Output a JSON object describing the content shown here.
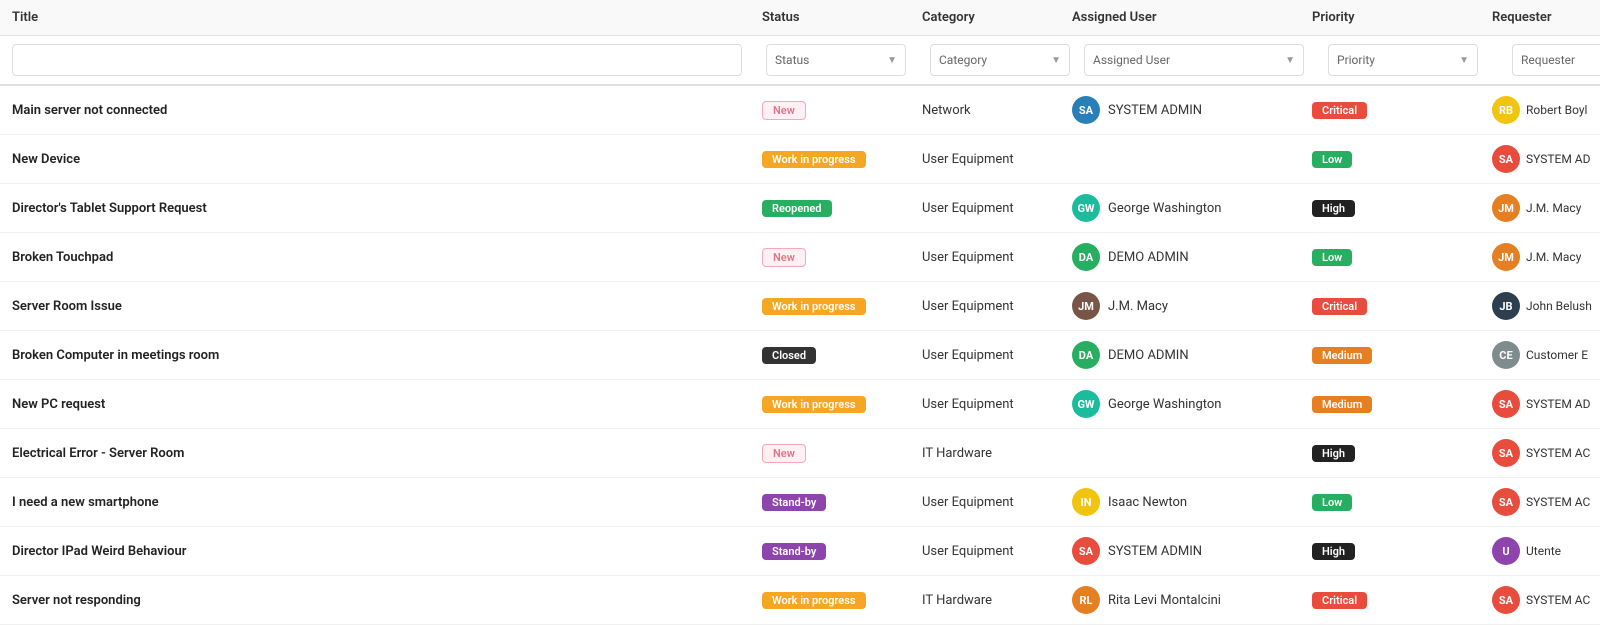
{
  "columns": {
    "title": "Title",
    "status": "Status",
    "category": "Category",
    "assigned_user": "Assigned User",
    "priority": "Priority",
    "requester": "Requester"
  },
  "filters": {
    "search_placeholder": "",
    "status_label": "Status",
    "category_label": "Category",
    "assigned_user_label": "Assigned User",
    "priority_label": "Priority",
    "requester_label": "Requester"
  },
  "rows": [
    {
      "title": "Main server not connected",
      "status": "New",
      "status_type": "new",
      "category": "Network",
      "assigned_user": "SYSTEM ADMIN",
      "assigned_avatar_color": "av-blue",
      "assigned_initials": "SA",
      "priority": "Critical",
      "priority_type": "critical",
      "requester": "Robert Boyl",
      "requester_avatar_color": "av-yellow",
      "requester_initials": "RB"
    },
    {
      "title": "New Device",
      "status": "Work in progress",
      "status_type": "wip",
      "category": "User Equipment",
      "assigned_user": "",
      "assigned_avatar_color": "",
      "assigned_initials": "",
      "priority": "Low",
      "priority_type": "low",
      "requester": "SYSTEM AD",
      "requester_avatar_color": "av-red",
      "requester_initials": "SA"
    },
    {
      "title": "Director's Tablet Support Request",
      "status": "Reopened",
      "status_type": "reopened",
      "category": "User Equipment",
      "assigned_user": "George Washington",
      "assigned_avatar_color": "av-teal",
      "assigned_initials": "GW",
      "priority": "High",
      "priority_type": "high",
      "requester": "J.M. Macy",
      "requester_avatar_color": "av-orange",
      "requester_initials": "JM"
    },
    {
      "title": "Broken Touchpad",
      "status": "New",
      "status_type": "new",
      "category": "User Equipment",
      "assigned_user": "DEMO ADMIN",
      "assigned_avatar_color": "av-green",
      "assigned_initials": "DA",
      "priority": "Low",
      "priority_type": "low",
      "requester": "J.M. Macy",
      "requester_avatar_color": "av-orange",
      "requester_initials": "JM"
    },
    {
      "title": "Server Room Issue",
      "status": "Work in progress",
      "status_type": "wip",
      "category": "User Equipment",
      "assigned_user": "J.M. Macy",
      "assigned_avatar_color": "av-brown",
      "assigned_initials": "JM",
      "priority": "Critical",
      "priority_type": "critical",
      "requester": "John Belush",
      "requester_avatar_color": "av-dark",
      "requester_initials": "JB"
    },
    {
      "title": "Broken Computer in meetings room",
      "status": "Closed",
      "status_type": "closed",
      "category": "User Equipment",
      "assigned_user": "DEMO ADMIN",
      "assigned_avatar_color": "av-green",
      "assigned_initials": "DA",
      "priority": "Medium",
      "priority_type": "medium",
      "requester": "Customer E",
      "requester_avatar_color": "av-gray",
      "requester_initials": "CE"
    },
    {
      "title": "New PC request",
      "status": "Work in progress",
      "status_type": "wip",
      "category": "User Equipment",
      "assigned_user": "George Washington",
      "assigned_avatar_color": "av-teal",
      "assigned_initials": "GW",
      "priority": "Medium",
      "priority_type": "medium",
      "requester": "SYSTEM AD",
      "requester_avatar_color": "av-red",
      "requester_initials": "SA"
    },
    {
      "title": "Electrical Error - Server Room",
      "status": "New",
      "status_type": "new",
      "category": "IT Hardware",
      "assigned_user": "",
      "assigned_avatar_color": "",
      "assigned_initials": "",
      "priority": "High",
      "priority_type": "high",
      "requester": "SYSTEM AC",
      "requester_avatar_color": "av-red",
      "requester_initials": "SA"
    },
    {
      "title": "I need a new smartphone",
      "status": "Stand-by",
      "status_type": "standby",
      "category": "User Equipment",
      "assigned_user": "Isaac Newton",
      "assigned_avatar_color": "av-yellow",
      "assigned_initials": "IN",
      "priority": "Low",
      "priority_type": "low",
      "requester": "SYSTEM AC",
      "requester_avatar_color": "av-red",
      "requester_initials": "SA"
    },
    {
      "title": "Director IPad Weird Behaviour",
      "status": "Stand-by",
      "status_type": "standby",
      "category": "User Equipment",
      "assigned_user": "SYSTEM ADMIN",
      "assigned_avatar_color": "av-red",
      "assigned_initials": "SA",
      "priority": "High",
      "priority_type": "high",
      "requester": "Utente",
      "requester_avatar_color": "av-purple",
      "requester_initials": "U"
    },
    {
      "title": "Server not responding",
      "status": "Work in progress",
      "status_type": "wip",
      "category": "IT Hardware",
      "assigned_user": "Rita Levi Montalcini",
      "assigned_avatar_color": "av-orange",
      "assigned_initials": "RL",
      "priority": "Critical",
      "priority_type": "critical",
      "requester": "SYSTEM AC",
      "requester_avatar_color": "av-red",
      "requester_initials": "SA"
    }
  ]
}
